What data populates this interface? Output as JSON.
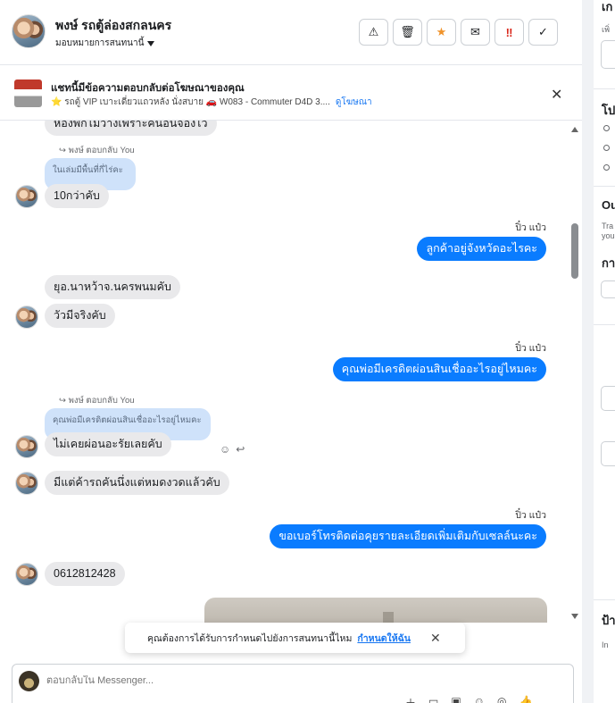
{
  "header": {
    "contact_name": "พงษ์ รถตู้ล่องสกลนคร",
    "assign_label": "มอบหมายการสนทนานี้",
    "actions": [
      {
        "name": "spam-button",
        "icon": "warning-icon",
        "glyph": "⚠"
      },
      {
        "name": "delete-button",
        "icon": "trash-icon",
        "glyph": "🗑"
      },
      {
        "name": "star-button",
        "icon": "star-icon",
        "glyph": "★"
      },
      {
        "name": "mark-unread-button",
        "icon": "envelope-open-icon",
        "glyph": "✉"
      },
      {
        "name": "priority-button",
        "icon": "double-exclamation-icon",
        "glyph": "‼"
      },
      {
        "name": "done-button",
        "icon": "check-icon",
        "glyph": "✓"
      }
    ]
  },
  "ad_bar": {
    "title": "แชทนี้มีข้อความตอบกลับต่อโฆษณาของคุณ",
    "subtitle": "⭐ รถตู้ VIP เบาะเดี่ยวแถวหลัง นั่งสบาย 🚗 W083 - Commuter D4D 3....",
    "link": "ดูโฆษณา",
    "close": "✕"
  },
  "thread": {
    "top_partial": "ห้องพักไม่ว่างเพราะคนอื่นจองไว้",
    "msg1_reply": "↪ พงษ์ ตอบกลับ You",
    "msg1_quote": "ในเล่มมีพื้นที่กี่ไร่คะ",
    "msg1_text": "10กว่าคับ",
    "out1_sender": "ปิ๋ว แป๋ว",
    "out1_text": "ลูกค้าอยู่จังหวัดอะไรคะ",
    "msg2_text": "ยุอ.นาหว้าจ.นครพนมคับ",
    "msg3_text": "วัวมีจริงคับ",
    "out2_sender": "ปิ๋ว แป๋ว",
    "out2_text": "คุณพ่อมีเครดิตผ่อนสินเชื่ออะไรอยู่ไหมคะ",
    "msg4_reply": "↪ พงษ์ ตอบกลับ You",
    "msg4_quote": "คุณพ่อมีเครดิตผ่อนสินเชื่ออะไรอยู่ไหมคะ",
    "msg4_text": "ไม่เคยผ่อนอะรัยเลยคับ",
    "msg5_text": "มีแต่ค้ารถคันนึ่งแต่หมดงวดแล้วคับ",
    "out3_sender": "ปิ๋ว แป๋ว",
    "out3_text": "ขอเบอร์โทรติดต่อคุยรายละเอียดเพิ่มเติมกับเซลล์นะคะ",
    "msg6_text": "0612812428"
  },
  "toast": {
    "text": "คุณต้องการได้รับการกำหนดไปยังการสนทนานี้ไหม",
    "link": "กำหนดให้ฉัน",
    "close": "✕"
  },
  "composer": {
    "placeholder": "ตอบกลับใน Messenger..."
  },
  "right_panel": {
    "t1": "เก",
    "t2": "เพิ่",
    "t3": "โป",
    "t4": "Ou",
    "t5": "Tra",
    "t6": "you",
    "t7": "กา",
    "t8": "ป้า",
    "t9": "In"
  },
  "colors": {
    "outgoing": "#0a7cff",
    "incoming": "#e9e9eb",
    "quote": "#cfe2fa",
    "link": "#1877f2"
  }
}
